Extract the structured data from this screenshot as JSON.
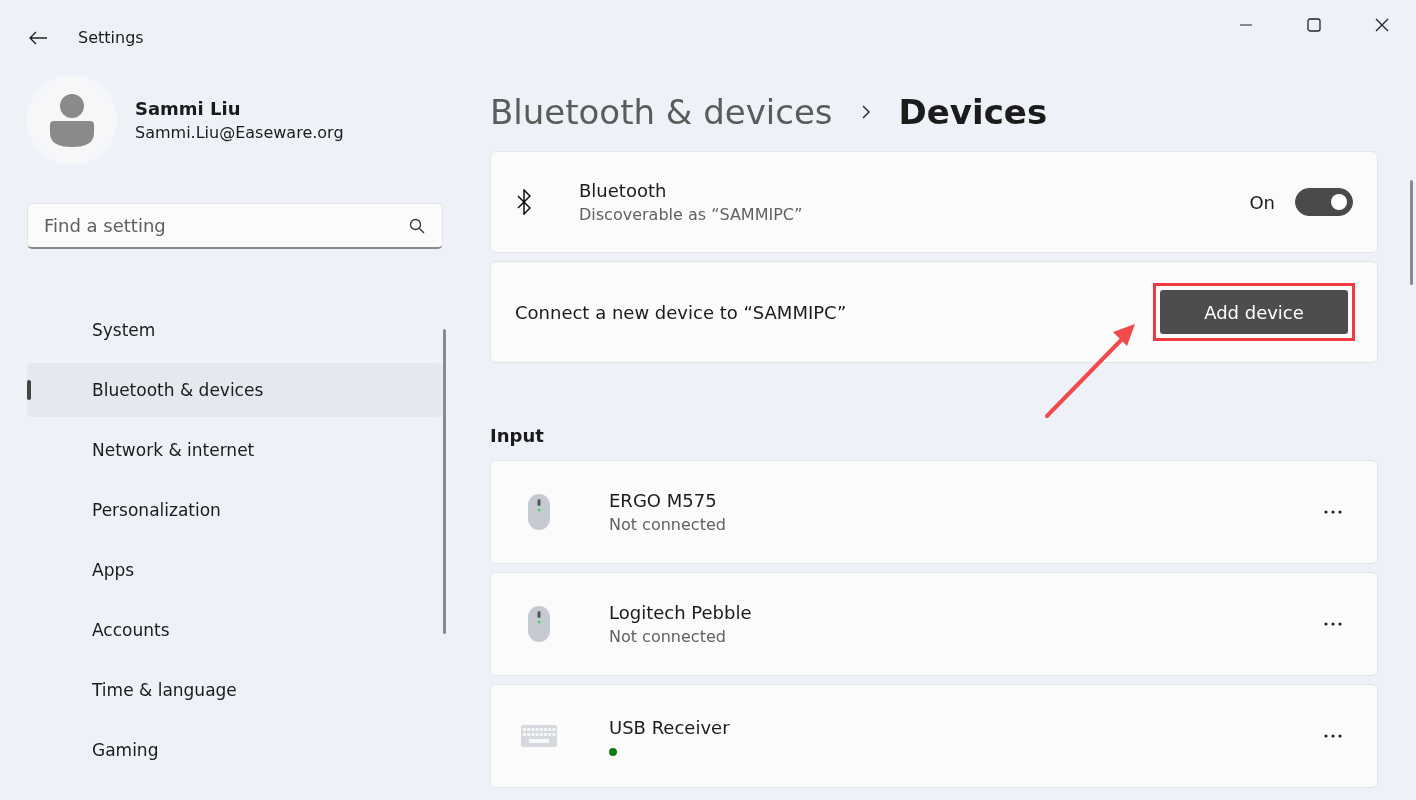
{
  "window": {
    "title": "Settings"
  },
  "account": {
    "name": "Sammi Liu",
    "email": "Sammi.Liu@Easeware.org"
  },
  "search": {
    "placeholder": "Find a setting"
  },
  "sidebar": {
    "items": [
      {
        "label": "System",
        "selected": false
      },
      {
        "label": "Bluetooth & devices",
        "selected": true
      },
      {
        "label": "Network & internet",
        "selected": false
      },
      {
        "label": "Personalization",
        "selected": false
      },
      {
        "label": "Apps",
        "selected": false
      },
      {
        "label": "Accounts",
        "selected": false
      },
      {
        "label": "Time & language",
        "selected": false
      },
      {
        "label": "Gaming",
        "selected": false
      }
    ]
  },
  "breadcrumb": [
    "Bluetooth & devices",
    "Devices"
  ],
  "bluetooth": {
    "title": "Bluetooth",
    "subtitle": "Discoverable as “SAMMIPC”",
    "toggle_label": "On",
    "on": true
  },
  "add_device": {
    "text": "Connect a new device to “SAMMIPC”",
    "button": "Add device",
    "highlighted": true
  },
  "input_section": {
    "heading": "Input",
    "devices": [
      {
        "kind": "mouse",
        "name": "ERGO M575",
        "status": "Not connected",
        "connected": false
      },
      {
        "kind": "mouse",
        "name": "Logitech Pebble",
        "status": "Not connected",
        "connected": false
      },
      {
        "kind": "keyboard",
        "name": "USB Receiver",
        "connected": true
      }
    ]
  }
}
